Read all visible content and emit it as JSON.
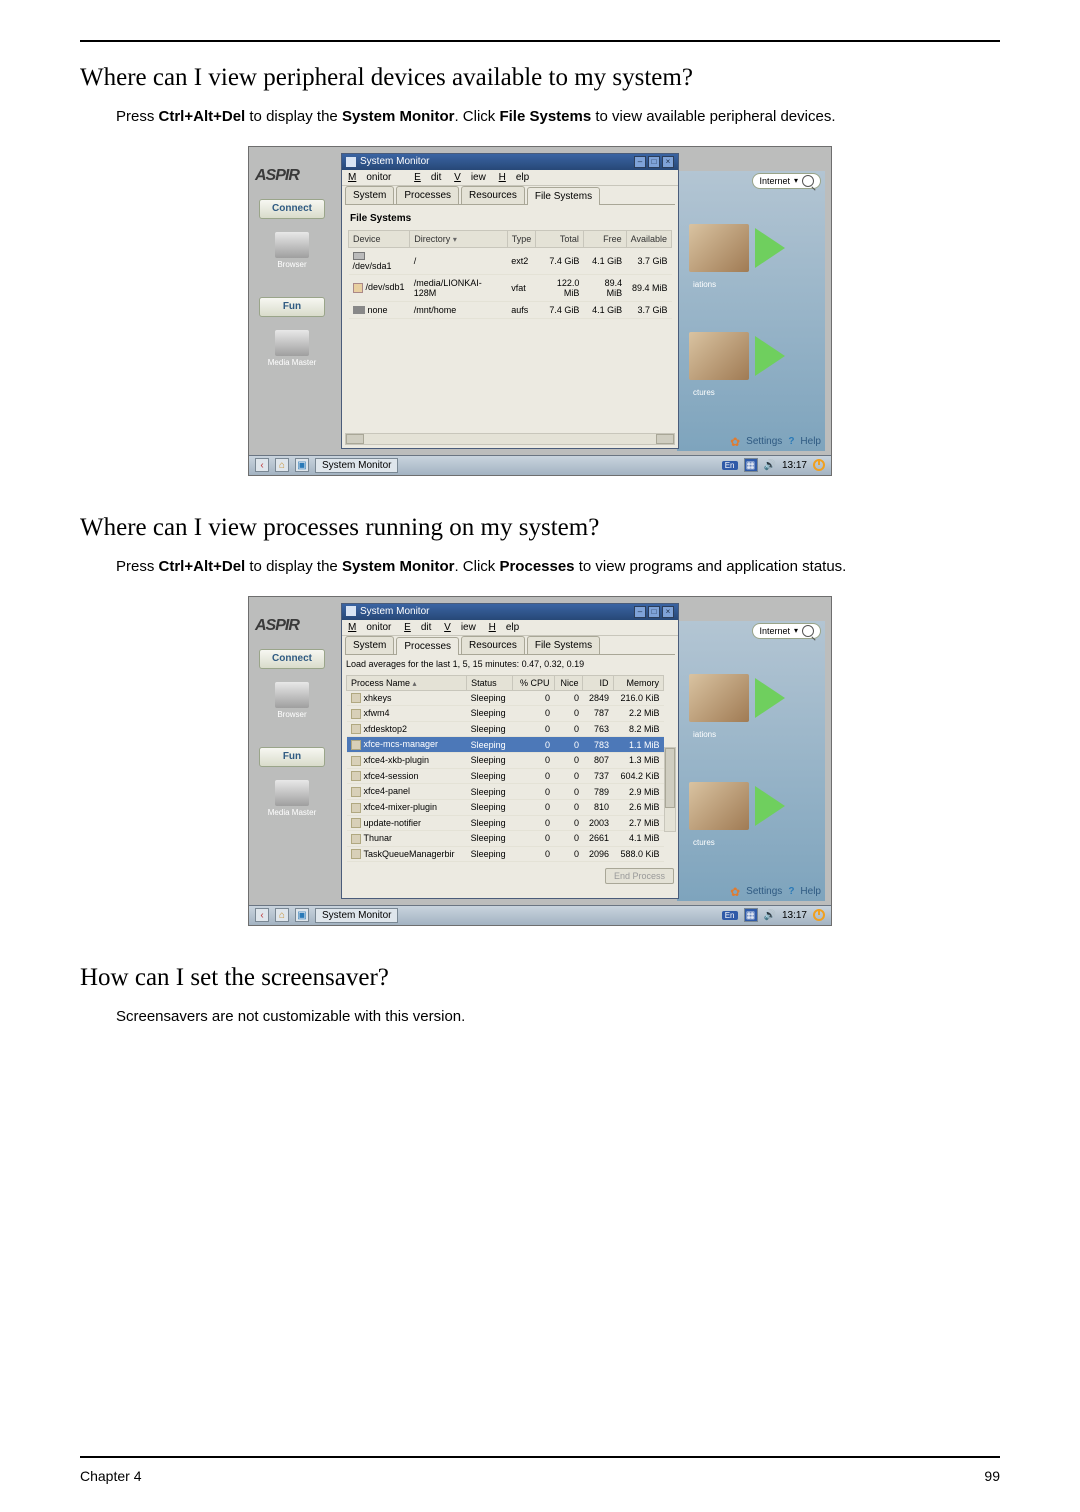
{
  "page": {
    "q1_heading": "Where can I view peripheral devices available to my system?",
    "q1_text_pre": "Press ",
    "q1_kbd": "Ctrl+Alt+Del",
    "q1_text_mid1": " to display the ",
    "q1_bold1": "System Monitor",
    "q1_text_mid2": ". Click ",
    "q1_bold2": "File Systems",
    "q1_text_end": " to view available peripheral devices.",
    "q2_heading": "Where can I view processes running on my system?",
    "q2_text_pre": "Press ",
    "q2_kbd": "Ctrl+Alt+Del",
    "q2_text_mid1": " to display the ",
    "q2_bold1": "System Monitor",
    "q2_text_mid2": ". Click ",
    "q2_bold2": "Processes",
    "q2_text_end": " to view programs and application status.",
    "q3_heading": "How can I set the screensaver?",
    "q3_text": "Screensavers are not customizable with this version.",
    "footer_left": "Chapter 4",
    "footer_right": "99"
  },
  "desktop": {
    "logo": "ASPIR",
    "connect": "Connect",
    "fun": "Fun",
    "browser": "Browser",
    "media_master": "Media Master",
    "internet": "Internet",
    "settings": "Settings",
    "help": "Help",
    "right_cap1": "iations",
    "right_cap2": "ctures"
  },
  "sm": {
    "title": "System Monitor",
    "menu": {
      "monitor": "Monitor",
      "edit": "Edit",
      "view": "View",
      "help": "Help"
    },
    "tabs": {
      "system": "System",
      "processes": "Processes",
      "resources": "Resources",
      "filesystems": "File Systems"
    },
    "fs": {
      "panel_title": "File Systems",
      "headers": {
        "device": "Device",
        "directory": "Directory",
        "type": "Type",
        "total": "Total",
        "free": "Free",
        "available": "Available"
      },
      "rows": [
        {
          "device": "/dev/sda1",
          "directory": "/",
          "type": "ext2",
          "total": "7.4 GiB",
          "free": "4.1 GiB",
          "available": "3.7 GiB"
        },
        {
          "device": "/dev/sdb1",
          "directory": "/media/LIONKAI-128M",
          "type": "vfat",
          "total": "122.0 MiB",
          "free": "89.4 MiB",
          "available": "89.4 MiB"
        },
        {
          "device": "none",
          "directory": "/mnt/home",
          "type": "aufs",
          "total": "7.4 GiB",
          "free": "4.1 GiB",
          "available": "3.7 GiB"
        }
      ]
    },
    "pr": {
      "loadavg": "Load averages for the last 1, 5, 15 minutes: 0.47, 0.32, 0.19",
      "headers": {
        "name": "Process Name",
        "status": "Status",
        "cpu": "% CPU",
        "nice": "Nice",
        "id": "ID",
        "memory": "Memory"
      },
      "rows": [
        {
          "name": "xhkeys",
          "status": "Sleeping",
          "cpu": "0",
          "nice": "0",
          "id": "2849",
          "memory": "216.0 KiB"
        },
        {
          "name": "xfwm4",
          "status": "Sleeping",
          "cpu": "0",
          "nice": "0",
          "id": "787",
          "memory": "2.2 MiB"
        },
        {
          "name": "xfdesktop2",
          "status": "Sleeping",
          "cpu": "0",
          "nice": "0",
          "id": "763",
          "memory": "8.2 MiB"
        },
        {
          "name": "xfce-mcs-manager",
          "status": "Sleeping",
          "cpu": "0",
          "nice": "0",
          "id": "783",
          "memory": "1.1 MiB"
        },
        {
          "name": "xfce4-xkb-plugin",
          "status": "Sleeping",
          "cpu": "0",
          "nice": "0",
          "id": "807",
          "memory": "1.3 MiB"
        },
        {
          "name": "xfce4-session",
          "status": "Sleeping",
          "cpu": "0",
          "nice": "0",
          "id": "737",
          "memory": "604.2 KiB"
        },
        {
          "name": "xfce4-panel",
          "status": "Sleeping",
          "cpu": "0",
          "nice": "0",
          "id": "789",
          "memory": "2.9 MiB"
        },
        {
          "name": "xfce4-mixer-plugin",
          "status": "Sleeping",
          "cpu": "0",
          "nice": "0",
          "id": "810",
          "memory": "2.6 MiB"
        },
        {
          "name": "update-notifier",
          "status": "Sleeping",
          "cpu": "0",
          "nice": "0",
          "id": "2003",
          "memory": "2.7 MiB"
        },
        {
          "name": "Thunar",
          "status": "Sleeping",
          "cpu": "0",
          "nice": "0",
          "id": "2661",
          "memory": "4.1 MiB"
        },
        {
          "name": "TaskQueueManagerbir",
          "status": "Sleeping",
          "cpu": "0",
          "nice": "0",
          "id": "2096",
          "memory": "588.0 KiB"
        }
      ],
      "end_process": "End Process"
    }
  },
  "taskbar": {
    "task_label": "System Monitor",
    "kb": "En",
    "time": "13:17"
  }
}
